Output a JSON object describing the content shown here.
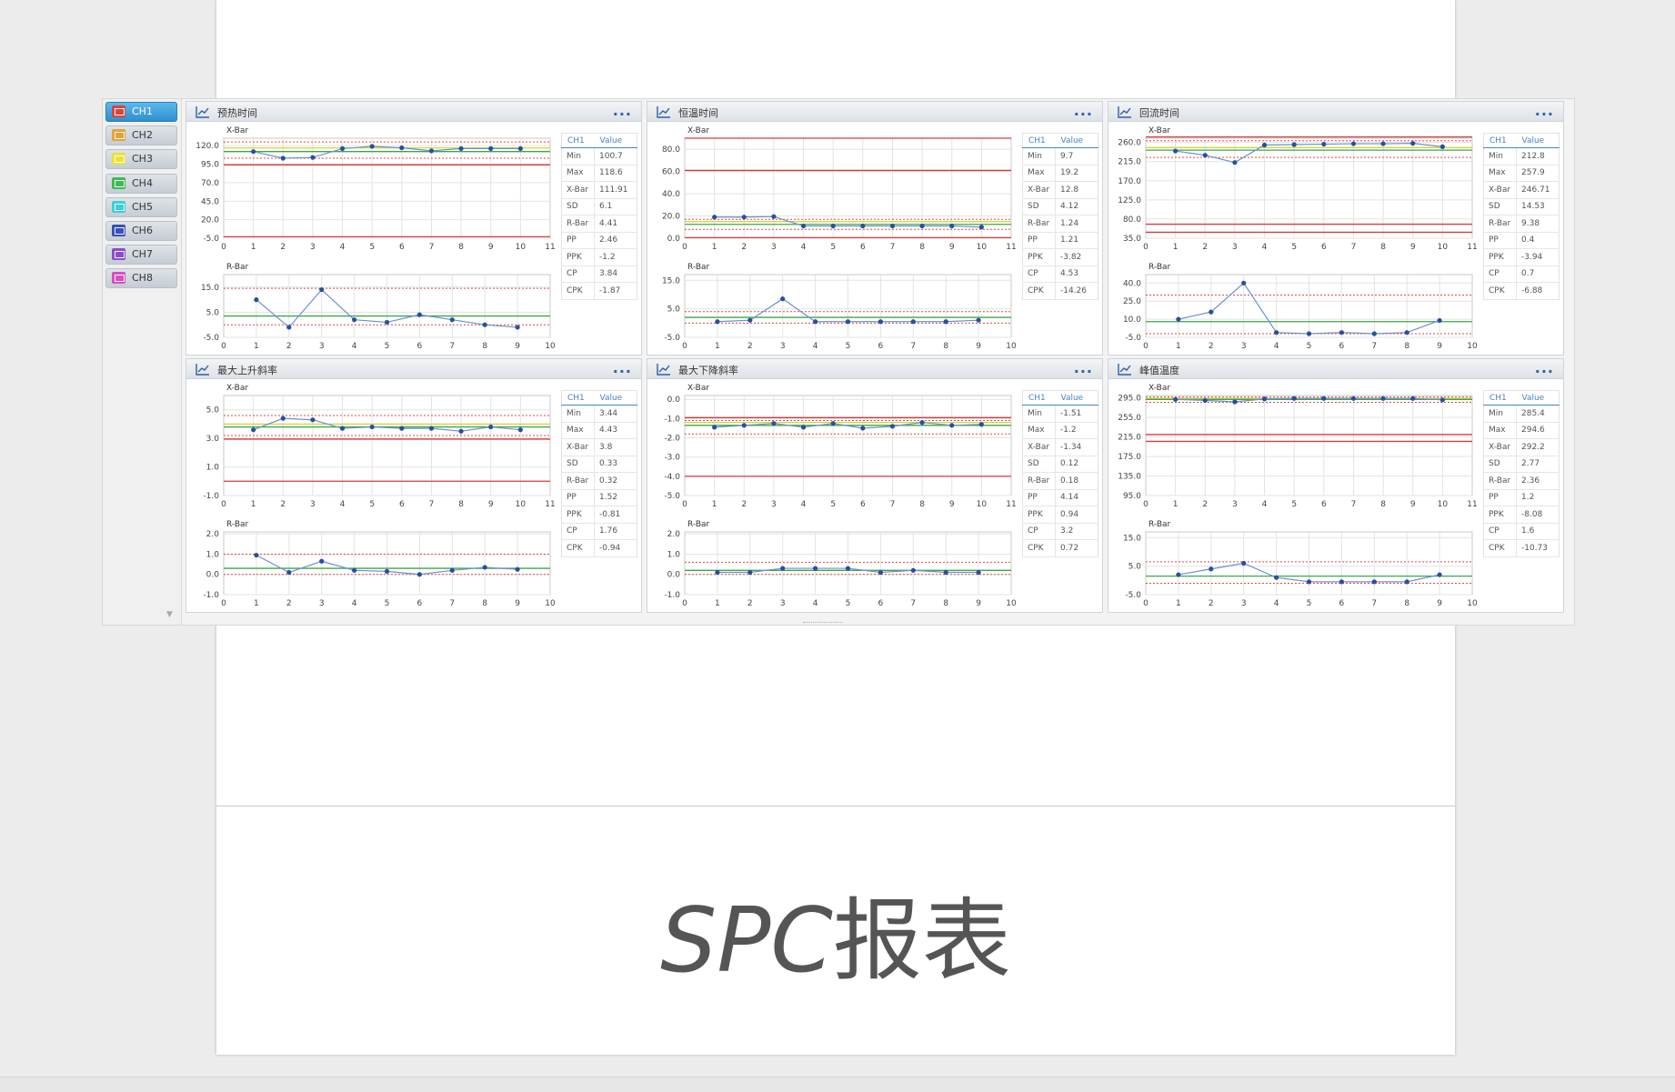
{
  "caption": {
    "latin": "SPC",
    "cjk": "报表"
  },
  "sidebar": {
    "items": [
      {
        "label": "CH1",
        "color": "#d9443a",
        "active": true
      },
      {
        "label": "CH2",
        "color": "#e7a23a",
        "active": false
      },
      {
        "label": "CH3",
        "color": "#e8e23a",
        "active": false
      },
      {
        "label": "CH4",
        "color": "#3dbb55",
        "active": false
      },
      {
        "label": "CH5",
        "color": "#3ccfd8",
        "active": false
      },
      {
        "label": "CH6",
        "color": "#3a4fb8",
        "active": false
      },
      {
        "label": "CH7",
        "color": "#8a4fc8",
        "active": false
      },
      {
        "label": "CH8",
        "color": "#d84fc2",
        "active": false
      }
    ]
  },
  "stats_header": {
    "col1": "CH1",
    "col2": "Value"
  },
  "stat_labels": [
    "Min",
    "Max",
    "X-Bar",
    "SD",
    "R-Bar",
    "PP",
    "PPK",
    "CP",
    "CPK"
  ],
  "more_icon": "...",
  "panels": [
    {
      "title": "预热时间",
      "stats": [
        "100.7",
        "118.6",
        "111.91",
        "6.1",
        "4.41",
        "2.46",
        "-1.2",
        "3.84",
        "-1.87"
      ],
      "xbar": {
        "label": "X-Bar",
        "yticks": [
          "120.0",
          "95.0",
          "70.0",
          "45.0",
          "20.0",
          "-5.0"
        ],
        "ymin": -5,
        "ymax": 130,
        "xticks": [
          "0",
          "1",
          "2",
          "3",
          "4",
          "5",
          "6",
          "7",
          "8",
          "9",
          "10",
          "11"
        ],
        "xmax": 11,
        "values": [
          112,
          103,
          104,
          116,
          119,
          117,
          113,
          116,
          116,
          116
        ],
        "red": [
          -3,
          94
        ],
        "red_dotted": [
          103,
          125
        ],
        "yellow": [
          117
        ],
        "green": [
          112
        ]
      },
      "rbar": {
        "label": "R-Bar",
        "yticks": [
          "15.0",
          "5.0",
          "-5.0"
        ],
        "ymin": -5,
        "ymax": 20,
        "xticks": [
          "0",
          "1",
          "2",
          "3",
          "4",
          "5",
          "6",
          "7",
          "8",
          "9",
          "10"
        ],
        "xmax": 10,
        "values": [
          10,
          -1,
          14,
          2,
          1,
          4,
          2,
          0,
          -1
        ],
        "red_dotted": [
          14.5,
          0
        ],
        "green": [
          3.5
        ]
      }
    },
    {
      "title": "恒温时间",
      "stats": [
        "9.7",
        "19.2",
        "12.8",
        "4.12",
        "1.24",
        "1.21",
        "-3.82",
        "4.53",
        "-14.26"
      ],
      "xbar": {
        "label": "X-Bar",
        "yticks": [
          "80.0",
          "60.0",
          "40.0",
          "20.0",
          "0.0"
        ],
        "ymin": 0,
        "ymax": 90,
        "xticks": [
          "0",
          "1",
          "2",
          "3",
          "4",
          "5",
          "6",
          "7",
          "8",
          "9",
          "10",
          "11"
        ],
        "xmax": 11,
        "values": [
          19,
          19,
          19.5,
          11,
          11,
          11,
          11,
          11,
          11,
          10
        ],
        "red": [
          0.5,
          61,
          90
        ],
        "red_dotted": [
          8,
          17
        ],
        "yellow": [
          15
        ],
        "green": [
          12.5
        ]
      },
      "rbar": {
        "label": "R-Bar",
        "yticks": [
          "15.0",
          "5.0",
          "-5.0"
        ],
        "ymin": -5,
        "ymax": 17,
        "xticks": [
          "0",
          "1",
          "2",
          "3",
          "4",
          "5",
          "6",
          "7",
          "8",
          "9",
          "10"
        ],
        "xmax": 10,
        "values": [
          0.5,
          1,
          8.5,
          0.5,
          0.5,
          0.5,
          0.5,
          0.5,
          1
        ],
        "red_dotted": [
          4,
          0
        ],
        "green": [
          2
        ]
      }
    },
    {
      "title": "回流时间",
      "stats": [
        "212.8",
        "257.9",
        "246.71",
        "14.53",
        "9.38",
        "0.4",
        "-3.94",
        "0.7",
        "-6.88"
      ],
      "xbar": {
        "label": "X-Bar",
        "yticks": [
          "260.0",
          "215.0",
          "170.0",
          "125.0",
          "80.0",
          "35.0"
        ],
        "ymin": 35,
        "ymax": 270,
        "xticks": [
          "0",
          "1",
          "2",
          "3",
          "4",
          "5",
          "6",
          "7",
          "8",
          "9",
          "10",
          "11"
        ],
        "xmax": 11,
        "values": [
          240,
          230,
          213,
          254,
          255,
          256,
          257,
          257,
          258,
          250
        ],
        "red": [
          49,
          68,
          273
        ],
        "red_dotted": [
          225,
          264
        ],
        "yellow": [
          248
        ],
        "green": [
          242
        ]
      },
      "rbar": {
        "label": "R-Bar",
        "yticks": [
          "40.0",
          "25.0",
          "10.0",
          "-5.0"
        ],
        "ymin": -5,
        "ymax": 47,
        "xticks": [
          "0",
          "1",
          "2",
          "3",
          "4",
          "5",
          "6",
          "7",
          "8",
          "9",
          "10"
        ],
        "xmax": 10,
        "values": [
          10,
          16,
          40,
          -1,
          -2,
          -1,
          -2,
          -1,
          9
        ],
        "red_dotted": [
          30,
          -2
        ],
        "green": [
          8
        ]
      }
    },
    {
      "title": "最大上升斜率",
      "stats": [
        "3.44",
        "4.43",
        "3.8",
        "0.33",
        "0.32",
        "1.52",
        "-0.81",
        "1.76",
        "-0.94"
      ],
      "xbar": {
        "label": "X-Bar",
        "yticks": [
          "5.0",
          "3.0",
          "1.0",
          "-1.0"
        ],
        "ymin": -1,
        "ymax": 6,
        "xticks": [
          "0",
          "1",
          "2",
          "3",
          "4",
          "5",
          "6",
          "7",
          "8",
          "9",
          "10",
          "11"
        ],
        "xmax": 11,
        "values": [
          3.6,
          4.4,
          4.3,
          3.7,
          3.8,
          3.7,
          3.7,
          3.5,
          3.8,
          3.6
        ],
        "red": [
          0,
          2.95
        ],
        "red_dotted": [
          3.2,
          4.6
        ],
        "yellow": [
          4.0
        ],
        "green": [
          3.8
        ]
      },
      "rbar": {
        "label": "R-Bar",
        "yticks": [
          "2.0",
          "1.0",
          "0.0",
          "-1.0"
        ],
        "ymin": -1,
        "ymax": 2.1,
        "xticks": [
          "0",
          "1",
          "2",
          "3",
          "4",
          "5",
          "6",
          "7",
          "8",
          "9",
          "10"
        ],
        "xmax": 10,
        "values": [
          0.95,
          0.1,
          0.65,
          0.2,
          0.15,
          0.0,
          0.2,
          0.35,
          0.25
        ],
        "red_dotted": [
          1.0,
          0.0
        ],
        "green": [
          0.3
        ]
      }
    },
    {
      "title": "最大下降斜率",
      "stats": [
        "-1.51",
        "-1.2",
        "-1.34",
        "0.12",
        "0.18",
        "4.14",
        "0.94",
        "3.2",
        "0.72"
      ],
      "xbar": {
        "label": "X-Bar",
        "yticks": [
          "0.0",
          "-1.0",
          "-2.0",
          "-3.0",
          "-4.0",
          "-5.0"
        ],
        "ymin": -5,
        "ymax": 0.2,
        "xticks": [
          "0",
          "1",
          "2",
          "3",
          "4",
          "5",
          "6",
          "7",
          "8",
          "9",
          "10",
          "11"
        ],
        "xmax": 11,
        "values": [
          -1.45,
          -1.35,
          -1.25,
          -1.45,
          -1.25,
          -1.5,
          -1.4,
          -1.2,
          -1.35,
          -1.3
        ],
        "red": [
          -0.95,
          -4.0
        ],
        "red_dotted": [
          -1.1,
          -1.8
        ],
        "yellow": [
          -1.2
        ],
        "green": [
          -1.35
        ]
      },
      "rbar": {
        "label": "R-Bar",
        "yticks": [
          "2.0",
          "1.0",
          "0.0",
          "-1.0"
        ],
        "ymin": -1,
        "ymax": 2.1,
        "xticks": [
          "0",
          "1",
          "2",
          "3",
          "4",
          "5",
          "6",
          "7",
          "8",
          "9",
          "10"
        ],
        "xmax": 10,
        "values": [
          0.1,
          0.1,
          0.3,
          0.3,
          0.3,
          0.1,
          0.2,
          0.1,
          0.1
        ],
        "red_dotted": [
          0.6,
          0.0
        ],
        "green": [
          0.2
        ]
      }
    },
    {
      "title": "峰值温度",
      "stats": [
        "285.4",
        "294.6",
        "292.2",
        "2.77",
        "2.36",
        "1.2",
        "-8.08",
        "1.6",
        "-10.73"
      ],
      "xbar": {
        "label": "X-Bar",
        "yticks": [
          "295.0",
          "255.0",
          "215.0",
          "175.0",
          "135.0",
          "95.0"
        ],
        "ymin": 95,
        "ymax": 300,
        "xticks": [
          "0",
          "1",
          "2",
          "3",
          "4",
          "5",
          "6",
          "7",
          "8",
          "9",
          "10",
          "11"
        ],
        "xmax": 11,
        "values": [
          292,
          290,
          287,
          293,
          294,
          294,
          294,
          294,
          294,
          291
        ],
        "red": [
          206,
          220
        ],
        "red_dotted": [
          286,
          297
        ],
        "yellow": [
          294
        ],
        "green": [
          292
        ]
      },
      "rbar": {
        "label": "R-Bar",
        "yticks": [
          "15.0",
          "5.0",
          "-5.0"
        ],
        "ymin": -5,
        "ymax": 17,
        "xticks": [
          "0",
          "1",
          "2",
          "3",
          "4",
          "5",
          "6",
          "7",
          "8",
          "9",
          "10"
        ],
        "xmax": 10,
        "values": [
          2,
          4,
          6,
          1,
          -0.5,
          -0.5,
          -0.5,
          -0.5,
          2
        ],
        "red_dotted": [
          6.5,
          -1
        ],
        "green": [
          1.5
        ]
      }
    }
  ]
}
